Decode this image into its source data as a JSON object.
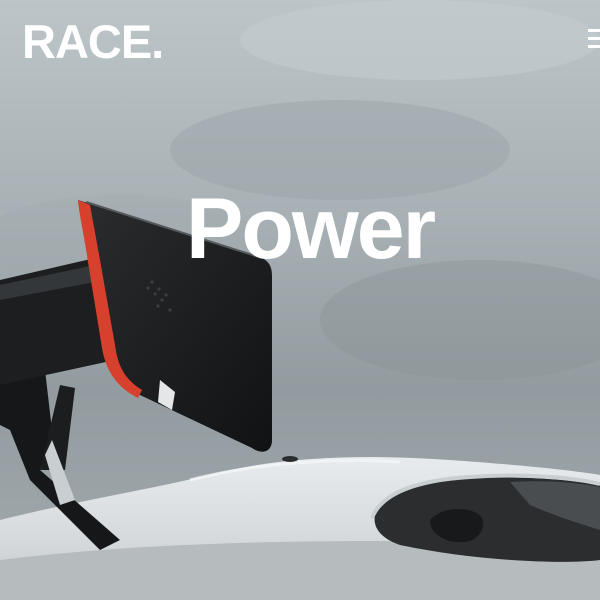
{
  "header": {
    "logo_text": "RACE.",
    "menu_icon": "hamburger-menu-icon"
  },
  "hero": {
    "headline": "Power",
    "background_image": "race-car-rear-wing-photo"
  },
  "colors": {
    "text": "#ffffff",
    "wing_accent": "#d6402c"
  }
}
